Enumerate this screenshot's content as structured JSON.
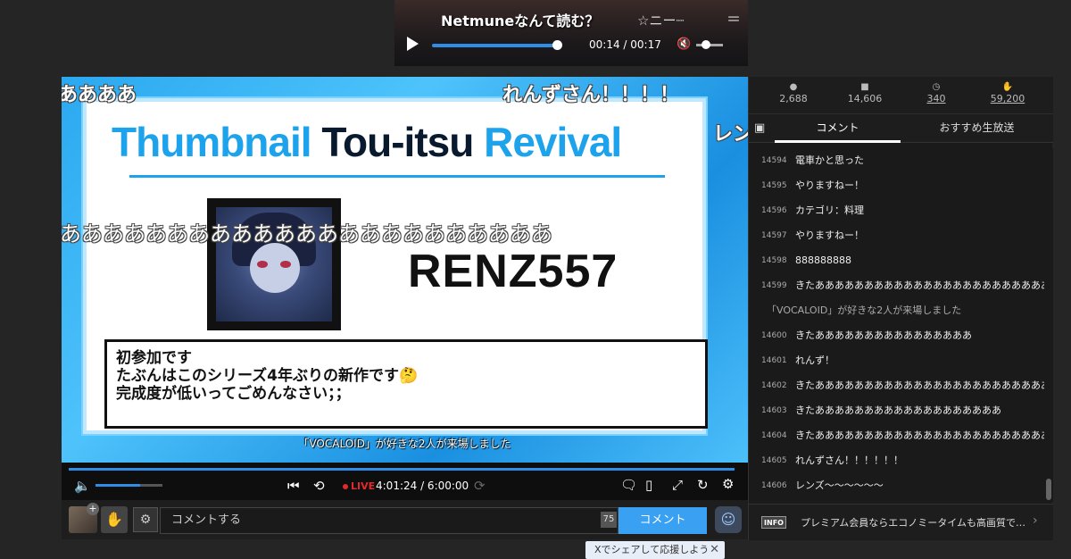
{
  "mini_player": {
    "caption": "Netmuneなんて読む？",
    "deco": "☆ニー┈",
    "deco_right": "＝",
    "time": "00:14 / 00:17",
    "mute_icon": "🔇",
    "progress": 0.93
  },
  "video": {
    "slide_title_1": "Thumbnail",
    "slide_title_2": " Tou-itsu ",
    "slide_title_3": "Revival",
    "creator_name": "RENZ557",
    "message_lines": [
      "初参加です",
      "たぶんはこのシリーズ4年ぶりの新作です🤔",
      "完成度が低いってごめんなさい；；"
    ],
    "subtitle": "「VOCALOID」が好きな2人が来場しました",
    "danmaku": [
      "ああああ",
      "れんずさん！！！！",
      "レン",
      "あああああああああああああああああああああああ"
    ]
  },
  "controls": {
    "live_label": "LIVE",
    "time": "4:01:24 / 6:00:00",
    "volume": 0.66,
    "progress": 0.99
  },
  "input_bar": {
    "placeholder": "コメントする",
    "char_count": "75",
    "submit_label": "コメント"
  },
  "share": {
    "label": "Xでシェアして応援しよう"
  },
  "panel": {
    "stats": [
      {
        "icon": "person-icon",
        "value": "2,688"
      },
      {
        "icon": "comment-icon",
        "value": "14,606"
      },
      {
        "icon": "clock-icon",
        "value": "340"
      },
      {
        "icon": "gift-icon",
        "value": "59,200"
      }
    ],
    "tabs": {
      "comment": "コメント",
      "recommend": "おすすめ生放送"
    },
    "comments": [
      {
        "no": "14594",
        "text": "電車かと思った"
      },
      {
        "no": "14595",
        "text": "やりますねー！"
      },
      {
        "no": "14596",
        "text": "カテゴリ：料理"
      },
      {
        "no": "14597",
        "text": "やりますねー！"
      },
      {
        "no": "14598",
        "text": "888888888"
      },
      {
        "no": "14599",
        "text": "きたあああああああああああああああああああああああああ"
      },
      {
        "no": "",
        "text": "「VOCALOID」が好きな2人が来場しました"
      },
      {
        "no": "14600",
        "text": "きたああああああああああああああああ"
      },
      {
        "no": "14601",
        "text": "れんず！"
      },
      {
        "no": "14602",
        "text": "きたあああああああああああああああああああああああああ"
      },
      {
        "no": "14603",
        "text": "きたあああああああああああああああああああ"
      },
      {
        "no": "14604",
        "text": "きたあああああああああああああああああああああああああ"
      },
      {
        "no": "14605",
        "text": "れんずさん！！！！！！"
      },
      {
        "no": "14606",
        "text": "レンズ〜〜〜〜〜〜"
      }
    ],
    "info_badge": "INFO",
    "info_text": "プレミアム会員ならエコノミータイムも高画質で…"
  }
}
